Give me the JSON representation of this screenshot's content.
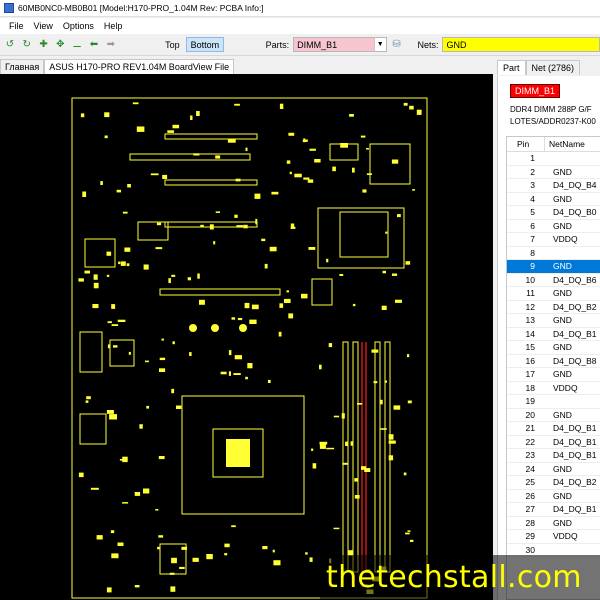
{
  "window": {
    "title": "60MB0NC0-MB0B01 [Model:H170-PRO_1.04M Rev: PCBA Info:]"
  },
  "menu": [
    "File",
    "View",
    "Options",
    "Help"
  ],
  "toolbar": {
    "top_label": "Top",
    "bottom_label": "Bottom",
    "parts_label": "Parts:",
    "parts_value": "DIMM_B1",
    "nets_label": "Nets:",
    "nets_value": "GND"
  },
  "doc_tabs": [
    "Главная",
    "ASUS H170-PRO REV1.04M BoardView File"
  ],
  "panel": {
    "tabs": [
      "Part",
      "Net (2786)"
    ],
    "part_name": "DIMM_B1",
    "description_line1": "DDR4 DIMM 288P G/F",
    "description_line2": "LOTES/ADDR0237-K00",
    "headers": {
      "pin": "Pin",
      "net": "NetName"
    },
    "selected_pin": "9",
    "rows": [
      {
        "pin": "1",
        "net": ""
      },
      {
        "pin": "2",
        "net": "GND"
      },
      {
        "pin": "3",
        "net": "D4_DQ_B4"
      },
      {
        "pin": "4",
        "net": "GND"
      },
      {
        "pin": "5",
        "net": "D4_DQ_B0"
      },
      {
        "pin": "6",
        "net": "GND"
      },
      {
        "pin": "7",
        "net": "VDDQ"
      },
      {
        "pin": "8",
        "net": ""
      },
      {
        "pin": "9",
        "net": "GND"
      },
      {
        "pin": "10",
        "net": "D4_DQ_B6"
      },
      {
        "pin": "11",
        "net": "GND"
      },
      {
        "pin": "12",
        "net": "D4_DQ_B2"
      },
      {
        "pin": "13",
        "net": "GND"
      },
      {
        "pin": "14",
        "net": "D4_DQ_B1"
      },
      {
        "pin": "15",
        "net": "GND"
      },
      {
        "pin": "16",
        "net": "D4_DQ_B8"
      },
      {
        "pin": "17",
        "net": "GND"
      },
      {
        "pin": "18",
        "net": "VDDQ"
      },
      {
        "pin": "19",
        "net": ""
      },
      {
        "pin": "20",
        "net": "GND"
      },
      {
        "pin": "21",
        "net": "D4_DQ_B1"
      },
      {
        "pin": "22",
        "net": "D4_DQ_B1"
      },
      {
        "pin": "23",
        "net": "D4_DQ_B1"
      },
      {
        "pin": "24",
        "net": "GND"
      },
      {
        "pin": "25",
        "net": "D4_DQ_B2"
      },
      {
        "pin": "26",
        "net": "GND"
      },
      {
        "pin": "27",
        "net": "D4_DQ_B1"
      },
      {
        "pin": "28",
        "net": "GND"
      },
      {
        "pin": "29",
        "net": "VDDQ"
      },
      {
        "pin": "30",
        "net": ""
      }
    ]
  },
  "watermark": "thetechstall.com",
  "colors": {
    "board_bg": "#000000",
    "component": "#ffff33",
    "highlight": "#ff2020",
    "parts_field": "#f7c5cf",
    "nets_field": "#ffff00",
    "selection": "#0078d7"
  }
}
